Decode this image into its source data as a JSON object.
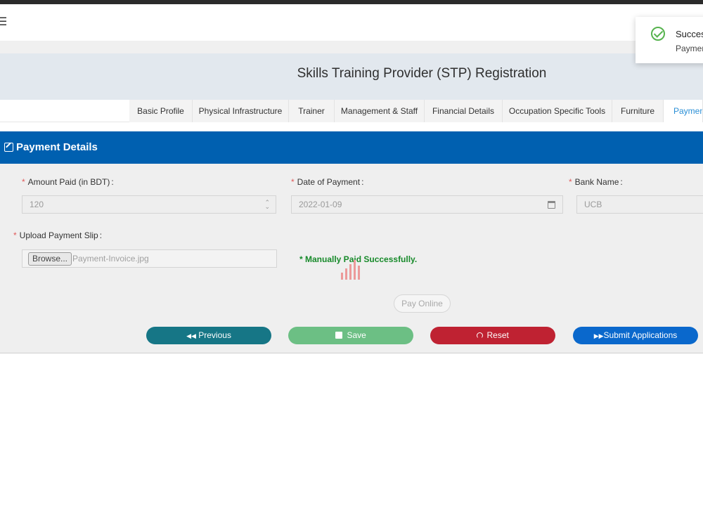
{
  "header": {
    "menu_icon": "hamburger-icon"
  },
  "banner": {
    "title": "Skills Training Provider (STP) Registration"
  },
  "tabs": [
    {
      "label": "Basic Profile"
    },
    {
      "label": "Physical Infrastructure"
    },
    {
      "label": "Trainer"
    },
    {
      "label": "Management & Staff"
    },
    {
      "label": "Financial Details"
    },
    {
      "label": "Occupation Specific Tools"
    },
    {
      "label": "Furniture"
    },
    {
      "label": "Payment"
    }
  ],
  "section": {
    "title": "Payment Details",
    "icon": "edit-icon"
  },
  "form": {
    "amount_label": "Amount Paid (in BDT)",
    "amount_value": "120",
    "date_label": "Date of Payment",
    "date_value": "2022-01-09",
    "bank_label": "Bank Name",
    "bank_value": "UCB",
    "upload_label": "Upload Payment Slip",
    "browse_label": "Browse...",
    "file_name": "Payment-Invoice.jpg",
    "paid_message": "* Manually Paid Successfully.",
    "colon": ":"
  },
  "buttons": {
    "pay_online": "Pay Online",
    "previous": "Previous",
    "save": "Save",
    "reset": "Reset",
    "submit": "Submit Applications"
  },
  "toast": {
    "title": "Success",
    "message": "Payment"
  },
  "colors": {
    "header_blue": "#0060b0",
    "previous": "#167686",
    "save": "#6cbf84",
    "reset": "#bf2232",
    "submit": "#0a68cc",
    "success_text": "#178a2a"
  }
}
